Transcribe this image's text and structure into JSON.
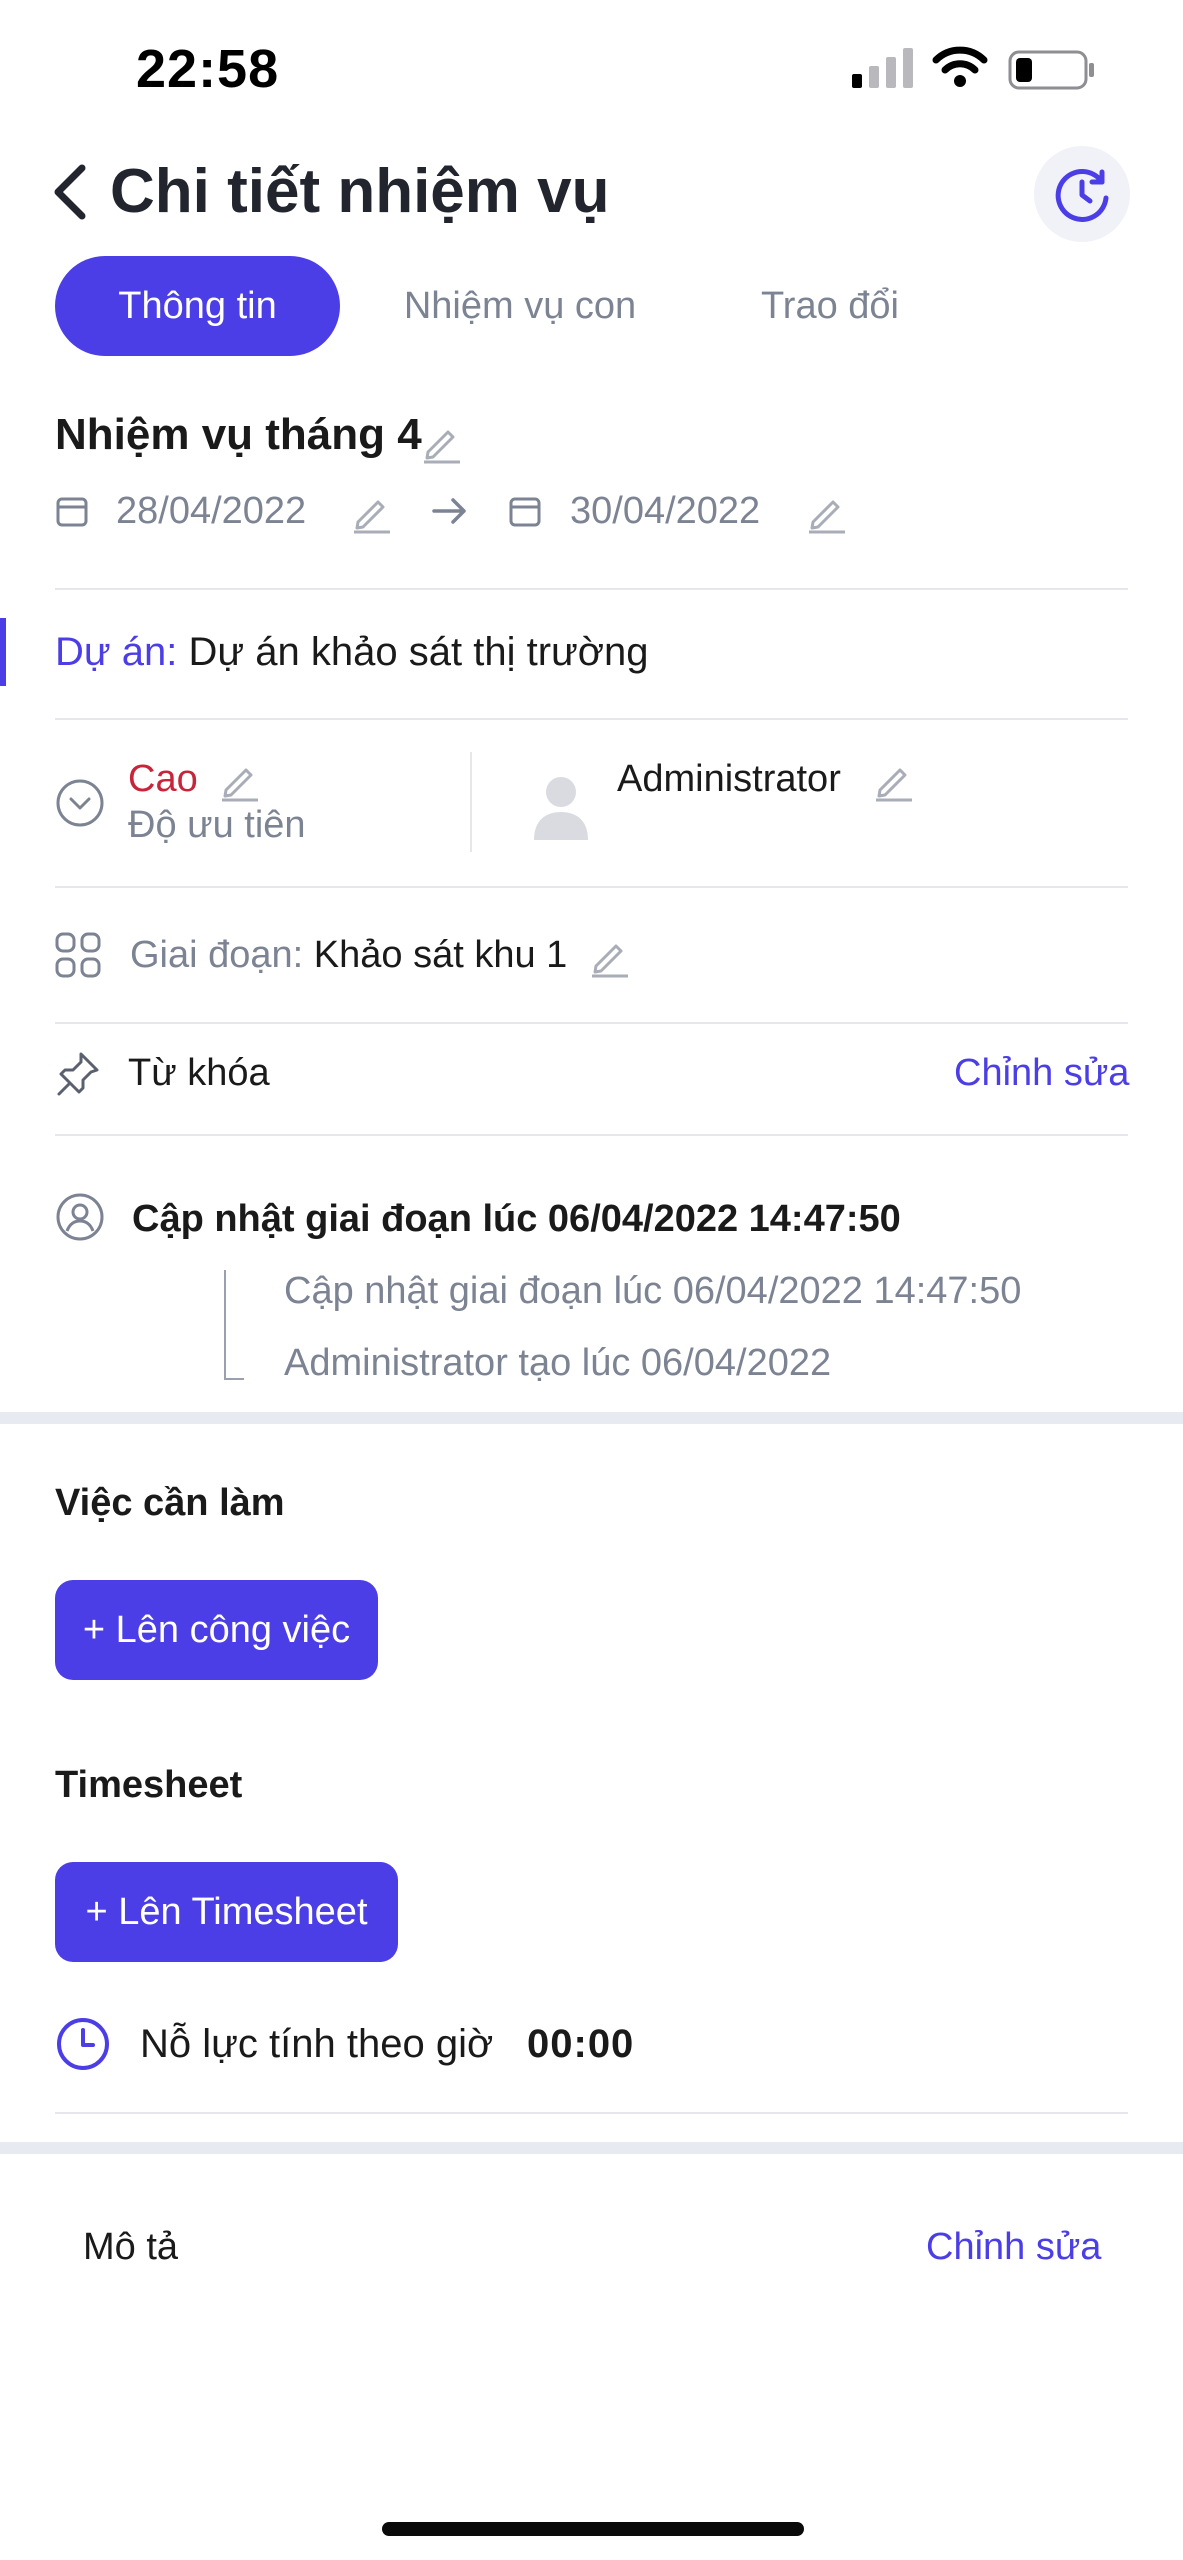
{
  "status_bar": {
    "time": "22:58"
  },
  "header": {
    "title": "Chi tiết nhiệm vụ"
  },
  "tabs": [
    {
      "label": "Thông tin",
      "active": true
    },
    {
      "label": "Nhiệm vụ con",
      "active": false
    },
    {
      "label": "Trao đổi",
      "active": false
    }
  ],
  "task": {
    "name": "Nhiệm vụ tháng 4",
    "start_date": "28/04/2022",
    "end_date": "30/04/2022"
  },
  "project": {
    "label": "Dự án:",
    "value": "Dự án khảo sát thị trường"
  },
  "priority": {
    "value": "Cao",
    "label": "Độ ưu tiên",
    "color": "#c7253a"
  },
  "assignee": {
    "name": "Administrator"
  },
  "stage": {
    "label": "Giai đoạn:",
    "value": "Khảo sát khu 1"
  },
  "keywords": {
    "label": "Từ khóa",
    "edit_label": "Chỉnh sửa"
  },
  "log": {
    "title": "Cập nhật giai đoạn lúc 06/04/2022 14:47:50",
    "items": [
      "Cập nhật giai đoạn lúc 06/04/2022 14:47:50",
      "Administrator tạo lúc 06/04/2022"
    ]
  },
  "todo": {
    "title": "Việc cần làm",
    "button_label": "+ Lên công việc"
  },
  "timesheet": {
    "title": "Timesheet",
    "button_label": "+ Lên Timesheet",
    "effort_label": "Nỗ lực tính theo giờ",
    "effort_value": "00:00"
  },
  "description": {
    "label": "Mô tả",
    "edit_label": "Chỉnh sửa"
  },
  "colors": {
    "accent": "#4b3ee6",
    "muted_text": "#7c8393",
    "priority_high": "#c7253a"
  },
  "icons": [
    "back-chevron-icon",
    "history-clock-icon",
    "calendar-icon",
    "arrow-right-icon",
    "pencil-icon",
    "chevron-circle-icon",
    "user-avatar-icon",
    "grid-icon",
    "pin-icon",
    "user-circle-icon",
    "clock-icon"
  ]
}
